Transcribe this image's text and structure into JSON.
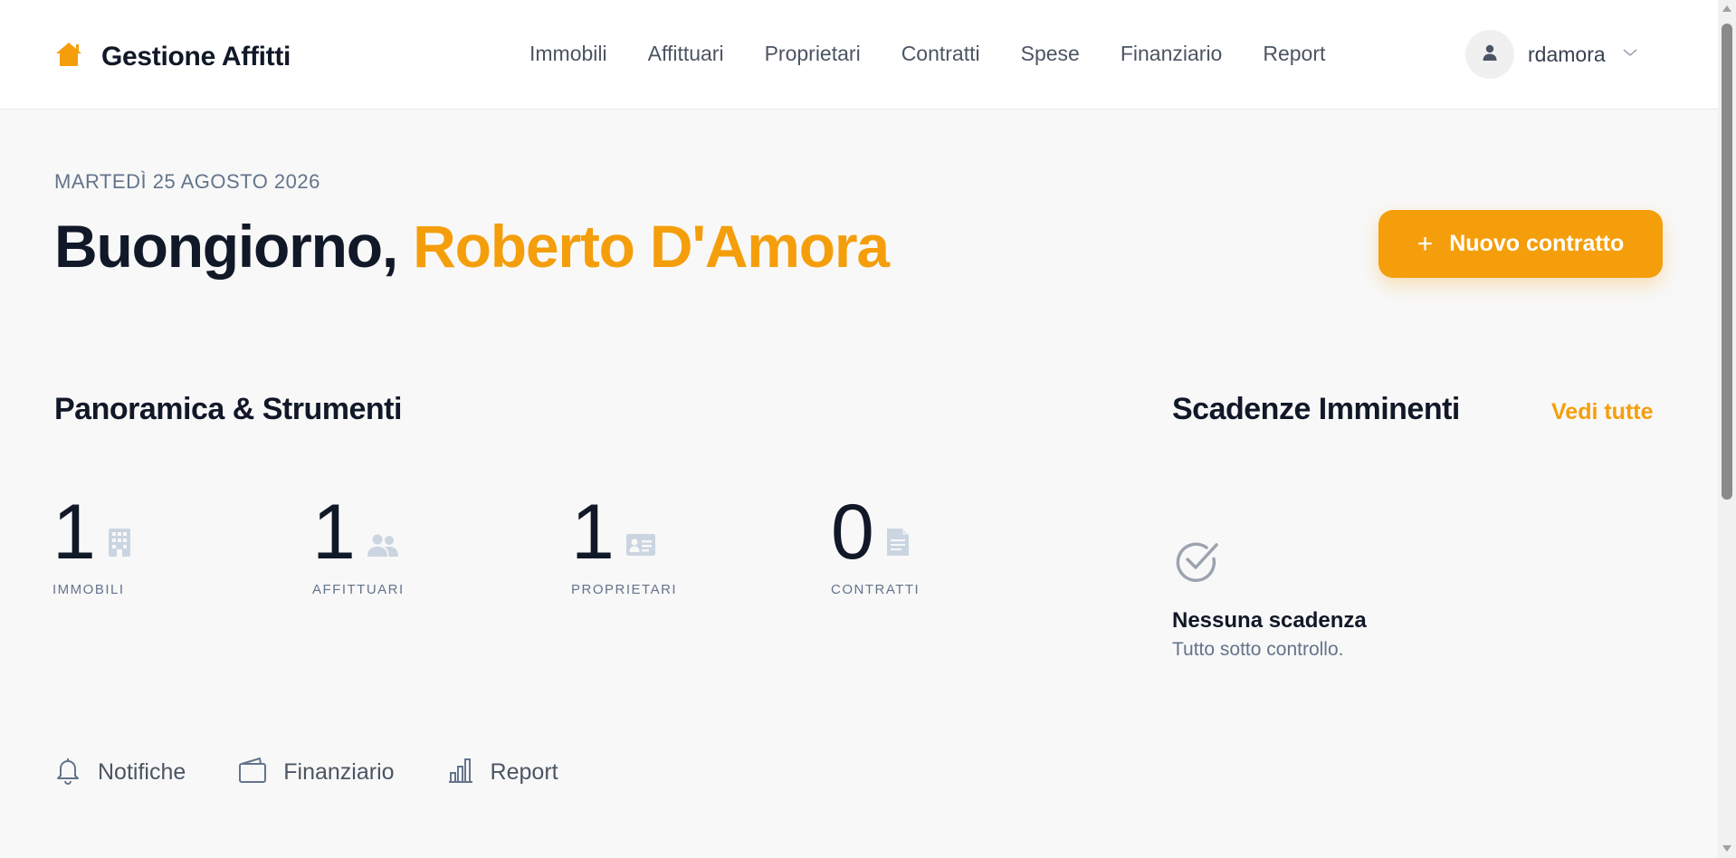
{
  "header": {
    "brand": "Gestione Affitti",
    "nav": [
      "Immobili",
      "Affittuari",
      "Proprietari",
      "Contratti",
      "Spese",
      "Finanziario",
      "Report"
    ],
    "username": "rdamora"
  },
  "hero": {
    "date": "MARTEDÌ 25 AGOSTO 2026",
    "greeting": "Buongiorno,",
    "name": "Roberto D'Amora",
    "new_contract_label": "Nuovo contratto",
    "new_contract_icon": "plus-icon"
  },
  "overview": {
    "title": "Panoramica & Strumenti",
    "stats": [
      {
        "value": "1",
        "label": "IMMOBILI",
        "icon": "building-icon"
      },
      {
        "value": "1",
        "label": "AFFITTUARI",
        "icon": "users-icon"
      },
      {
        "value": "1",
        "label": "PROPRIETARI",
        "icon": "id-card-icon"
      },
      {
        "value": "0",
        "label": "CONTRATTI",
        "icon": "document-icon"
      }
    ],
    "tools": [
      {
        "label": "Notifiche",
        "icon": "bell-icon"
      },
      {
        "label": "Finanziario",
        "icon": "wallet-icon"
      },
      {
        "label": "Report",
        "icon": "bar-chart-icon"
      }
    ]
  },
  "deadlines": {
    "title": "Scadenze Imminenti",
    "see_all": "Vedi tutte",
    "empty_title": "Nessuna scadenza",
    "empty_subtitle": "Tutto sotto controllo.",
    "empty_icon": "check-circle-icon"
  },
  "colors": {
    "accent": "#f59e0b",
    "text": "#111827",
    "muted": "#64748b",
    "background": "#f8f8f8"
  }
}
